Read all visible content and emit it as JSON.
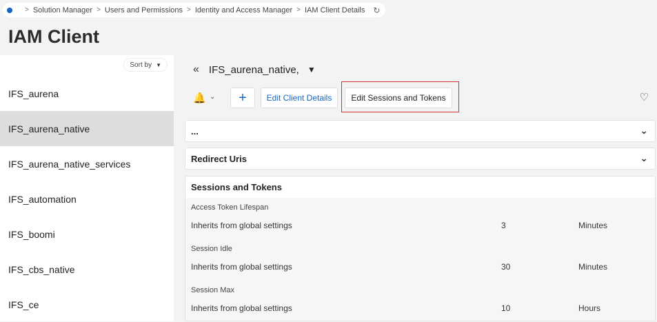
{
  "breadcrumb": {
    "items": [
      "Solution Manager",
      "Users and Permissions",
      "Identity and Access Manager",
      "IAM Client Details"
    ]
  },
  "page": {
    "title": "IAM Client"
  },
  "sidebar": {
    "sort_label": "Sort by",
    "items": [
      {
        "label": "IFS_aurena",
        "selected": false
      },
      {
        "label": "IFS_aurena_native",
        "selected": true
      },
      {
        "label": "IFS_aurena_native_services",
        "selected": false
      },
      {
        "label": "IFS_automation",
        "selected": false
      },
      {
        "label": "IFS_boomi",
        "selected": false
      },
      {
        "label": "IFS_cbs_native",
        "selected": false
      },
      {
        "label": "IFS_ce",
        "selected": false
      }
    ]
  },
  "detail": {
    "title": "IFS_aurena_native,",
    "toolbar": {
      "add_label": "+",
      "edit_client_label": "Edit Client Details",
      "edit_sessions_label": "Edit Sessions and Tokens"
    },
    "panels": {
      "general_title": "...",
      "redirect_title": "Redirect Uris",
      "sessions_title": "Sessions and Tokens"
    },
    "sessions": [
      {
        "label": "Access Token Lifespan",
        "inherit": "Inherits from global settings",
        "value": "3",
        "unit": "Minutes"
      },
      {
        "label": "Session Idle",
        "inherit": "Inherits from global settings",
        "value": "30",
        "unit": "Minutes"
      },
      {
        "label": "Session Max",
        "inherit": "Inherits from global settings",
        "value": "10",
        "unit": "Hours"
      }
    ]
  },
  "colors": {
    "accent": "#1565c0",
    "highlight": "#d32f2f",
    "selected_row": "#dddddd"
  },
  "icons": [
    "home-icon",
    "refresh-icon",
    "caret-down-icon",
    "double-chevron-left-icon",
    "bell-icon",
    "chevron-down-icon",
    "heart-icon"
  ]
}
